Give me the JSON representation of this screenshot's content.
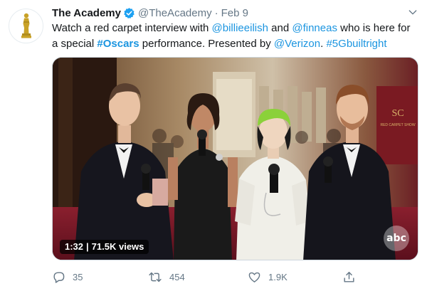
{
  "tweet": {
    "display_name": "The Academy",
    "handle": "@TheAcademy",
    "separator": "·",
    "date": "Feb 9",
    "text_parts": {
      "p1": "Watch a red carpet interview with ",
      "mention1": "@billieeilish",
      "p2": " and ",
      "mention2": "@finneas",
      "p3": " who is here for a special ",
      "hashtag1": "#Oscars",
      "p4": " performance. Presented by ",
      "mention3": "@Verizon",
      "p5": ". ",
      "hashtag2": "#5Gbuiltright"
    }
  },
  "media": {
    "duration": "1:32",
    "views": "71.5K views",
    "separator": "|",
    "watermark": "abc",
    "backdrop_sign": "RED CARPET SHOW",
    "backdrop_monogram": "SC"
  },
  "actions": {
    "reply_count": "35",
    "retweet_count": "454",
    "like_count": "1.9K"
  },
  "colors": {
    "link": "#1b95e0",
    "secondary_text": "#657786",
    "verified": "#1da1f2",
    "oscar_gold": "#c9a227"
  },
  "icons": [
    "oscar-statue-icon",
    "verified-badge-icon",
    "chevron-down-icon",
    "reply-icon",
    "retweet-icon",
    "heart-icon",
    "share-icon"
  ]
}
